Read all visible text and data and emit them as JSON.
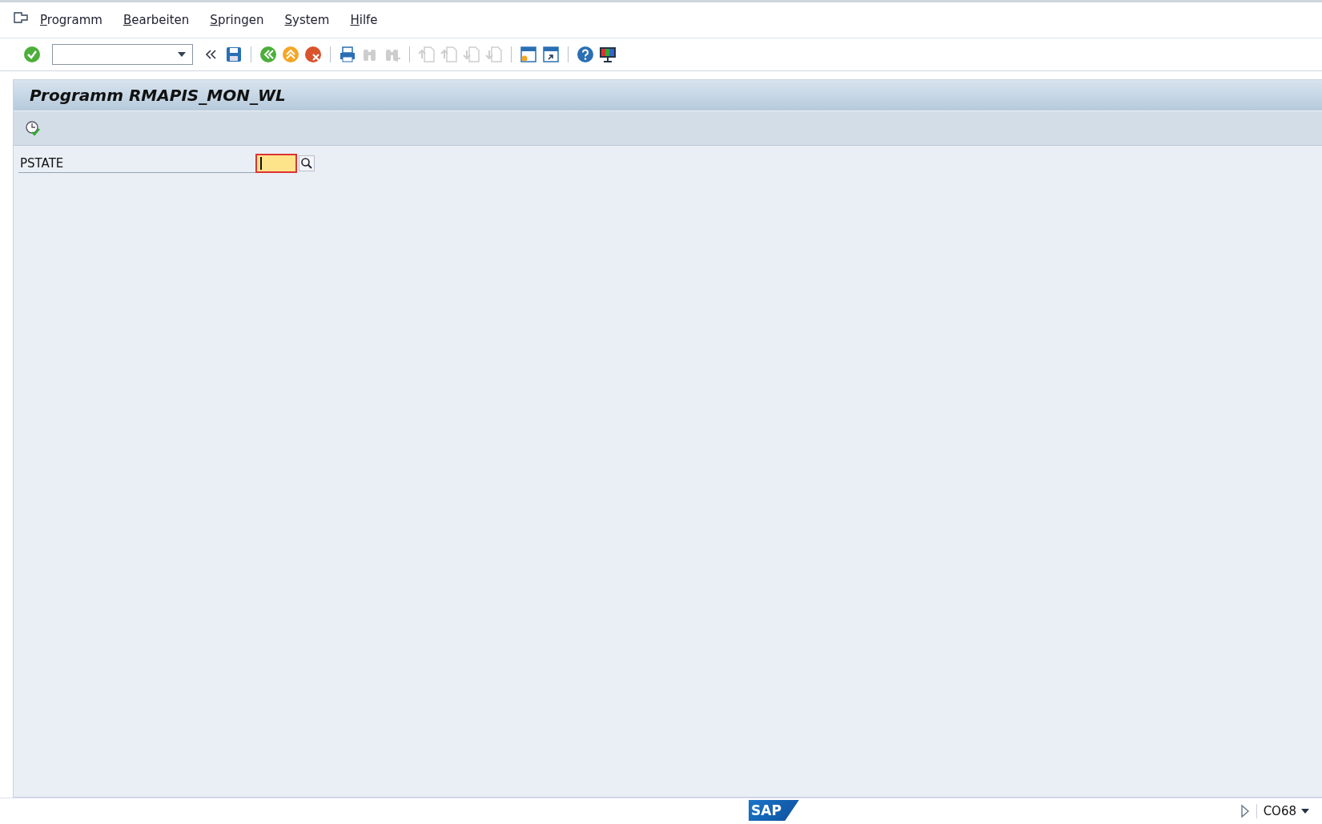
{
  "menu": [
    "Programm",
    "Bearbeiten",
    "Springen",
    "System",
    "Hilfe"
  ],
  "toolbar": [
    {
      "kind": "enter",
      "disabled": false
    },
    {
      "kind": "command-field"
    },
    {
      "kind": "collapse",
      "disabled": false
    },
    {
      "kind": "save",
      "disabled": false
    },
    {
      "kind": "sep"
    },
    {
      "kind": "back",
      "disabled": false
    },
    {
      "kind": "exit",
      "disabled": false
    },
    {
      "kind": "cancel",
      "disabled": false
    },
    {
      "kind": "sep"
    },
    {
      "kind": "print",
      "disabled": false
    },
    {
      "kind": "find",
      "disabled": true
    },
    {
      "kind": "find-next",
      "disabled": true
    },
    {
      "kind": "sep"
    },
    {
      "kind": "first-page",
      "disabled": true
    },
    {
      "kind": "prev-page",
      "disabled": true
    },
    {
      "kind": "next-page",
      "disabled": true
    },
    {
      "kind": "last-page",
      "disabled": true
    },
    {
      "kind": "sep"
    },
    {
      "kind": "new-session",
      "disabled": false
    },
    {
      "kind": "shortcut",
      "disabled": false
    },
    {
      "kind": "sep"
    },
    {
      "kind": "help",
      "disabled": false
    },
    {
      "kind": "layout",
      "disabled": false
    }
  ],
  "title": "Programm RMAPIS_MON_WL",
  "app_toolbar": [
    {
      "kind": "execute-variant"
    }
  ],
  "fields": [
    {
      "label": "PSTATE",
      "focused": true
    }
  ],
  "status_bar": {
    "logo": "SAP",
    "system": "CO68"
  }
}
